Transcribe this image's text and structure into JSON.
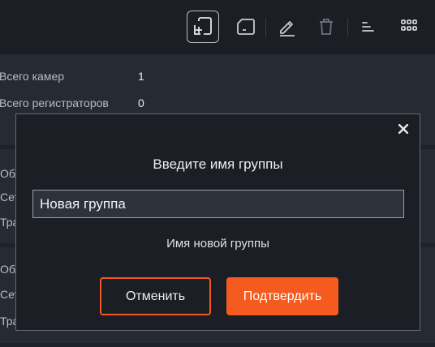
{
  "toolbar": {
    "buttons": [
      {
        "icon": "add-group-icon",
        "active": true
      },
      {
        "icon": "remove-group-icon"
      },
      {
        "icon": "pencil-icon"
      },
      {
        "icon": "trash-icon"
      },
      {
        "icon": "sort-icon"
      },
      {
        "icon": "grid-icon"
      }
    ]
  },
  "info": {
    "cameras_label": "Всего камер",
    "cameras_value": "1",
    "recorders_label": "Всего регистраторов",
    "recorders_value": "0"
  },
  "background_rows": [
    {
      "label": "Обл"
    },
    {
      "label": "Сет"
    },
    {
      "label": "Тра"
    },
    {
      "label": "Обл"
    },
    {
      "label": "Сет"
    },
    {
      "label": "Тра"
    }
  ],
  "dialog": {
    "close_symbol": "✕",
    "title": "Введите имя группы",
    "input_value": "Новая группа",
    "hint": "Имя новой группы",
    "cancel_label": "Отменить",
    "confirm_label": "Подтвердить"
  },
  "colors": {
    "accent": "#f55a1e",
    "background": "#1e2229",
    "panel": "#262b33"
  }
}
